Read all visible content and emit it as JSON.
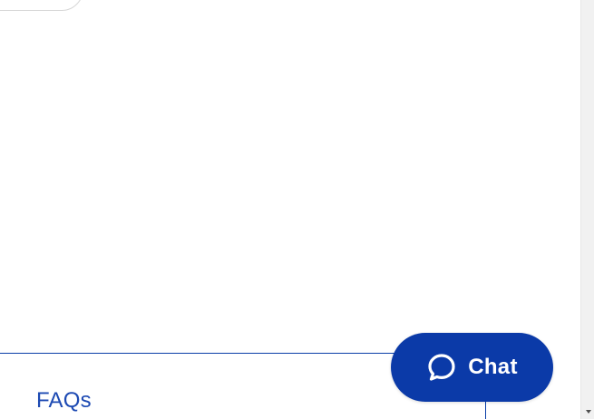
{
  "footer": {
    "faq_label": "FAQs"
  },
  "chat_widget": {
    "label": "Chat",
    "icon": "chat-bubble-icon",
    "color": "#0b3aa8"
  },
  "colors": {
    "link": "#1d4ab3",
    "divider": "#0a3fa8",
    "background": "#ffffff"
  }
}
